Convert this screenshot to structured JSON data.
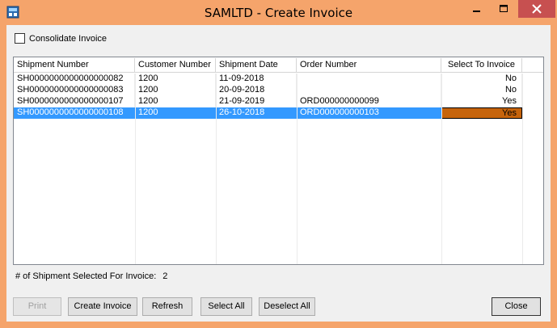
{
  "window": {
    "title": "SAMLTD - Create Invoice",
    "accent": "#f5a46b"
  },
  "consolidate": {
    "label": "Consolidate Invoice",
    "checked": false
  },
  "grid": {
    "columns": [
      "Shipment Number",
      "Customer Number",
      "Shipment Date",
      "Order Number",
      "Select To Invoice"
    ],
    "rows": [
      {
        "shipment": "SH0000000000000000082",
        "customer": "1200",
        "date": "11-09-2018",
        "order": "",
        "select": "No"
      },
      {
        "shipment": "SH0000000000000000083",
        "customer": "1200",
        "date": "20-09-2018",
        "order": "",
        "select": "No"
      },
      {
        "shipment": "SH0000000000000000107",
        "customer": "1200",
        "date": "21-09-2019",
        "order": "ORD000000000099",
        "select": "Yes"
      },
      {
        "shipment": "SH0000000000000000108",
        "customer": "1200",
        "date": "26-10-2018",
        "order": "ORD000000000103",
        "select": "Yes"
      }
    ],
    "selected_color": "#3399ff",
    "focus_color": "#c6640c"
  },
  "summary": {
    "label": "# of Shipment Selected For Invoice:",
    "count": "2"
  },
  "buttons": {
    "print": "Print",
    "create_invoice": "Create Invoice",
    "refresh": "Refresh",
    "select_all": "Select All",
    "deselect_all": "Deselect All",
    "close": "Close"
  }
}
